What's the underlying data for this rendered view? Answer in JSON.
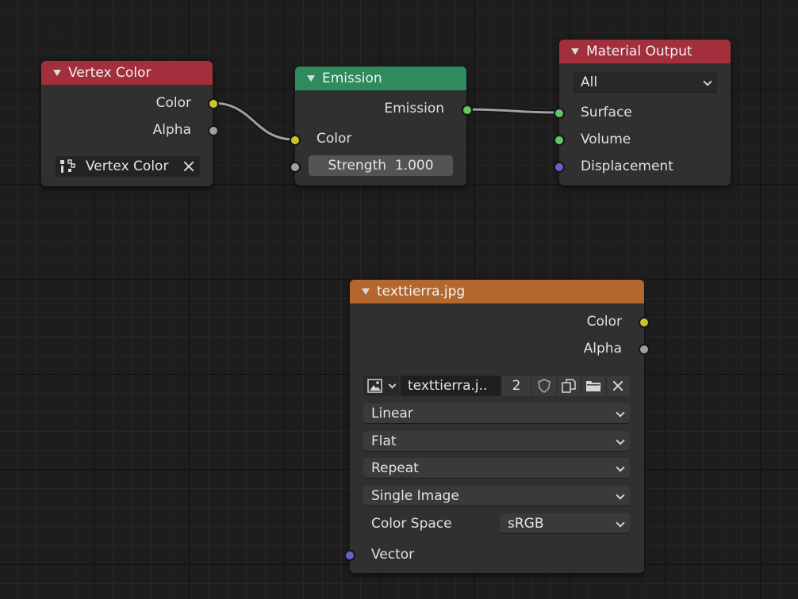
{
  "colors": {
    "vertex_color_header": "#a32f3d",
    "emission_header": "#2e8b5e",
    "output_header": "#a32f3d",
    "image_header": "#b4672c",
    "socket_color": "#c7c729",
    "socket_float": "#a1a1a1",
    "socket_shader": "#63c763",
    "socket_vector": "#6363c7"
  },
  "vertex_color_node": {
    "title": "Vertex Color",
    "outputs": [
      "Color",
      "Alpha"
    ],
    "layer_field": "Vertex Color"
  },
  "emission_node": {
    "title": "Emission",
    "output": "Emission",
    "input_color": "Color",
    "strength_label": "Strength",
    "strength_value": "1.000"
  },
  "material_output_node": {
    "title": "Material Output",
    "target": "All",
    "inputs": [
      "Surface",
      "Volume",
      "Displacement"
    ]
  },
  "image_node": {
    "title": "texttierra.jpg",
    "outputs": [
      "Color",
      "Alpha"
    ],
    "image_name": "texttierra.j..",
    "users": "2",
    "interpolation": "Linear",
    "projection": "Flat",
    "extension": "Repeat",
    "source": "Single Image",
    "color_space_label": "Color Space",
    "color_space_value": "sRGB",
    "input_vector": "Vector"
  }
}
